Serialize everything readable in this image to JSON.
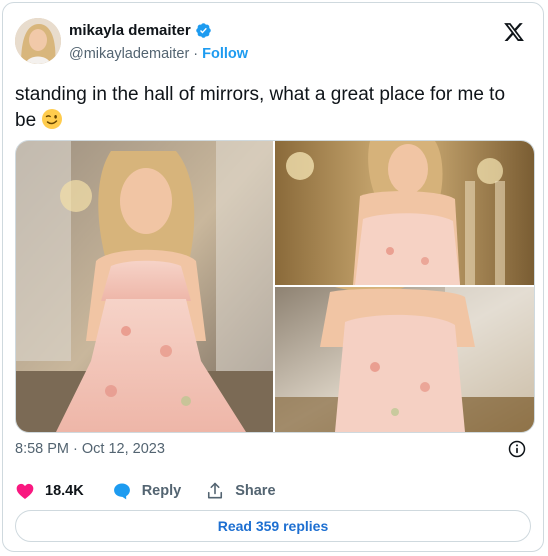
{
  "author": {
    "display_name": "mikayla demaiter",
    "handle": "@mikaylademaiter",
    "follow_label": "Follow",
    "verified": true
  },
  "tweet": {
    "text": "standing in the hall of mirrors, what a great place for me to be",
    "emoji": "winking-face-emoji",
    "timestamp": "8:58 PM · Oct 12, 2023",
    "media": [
      "photo-1",
      "photo-2",
      "photo-3"
    ]
  },
  "actions": {
    "likes": "18.4K",
    "reply_label": "Reply",
    "share_label": "Share"
  },
  "read_replies_label": "Read 359 replies",
  "colors": {
    "accent": "#1d9bf0",
    "like": "#f91880",
    "muted": "#536471",
    "border": "#cfd9de"
  }
}
